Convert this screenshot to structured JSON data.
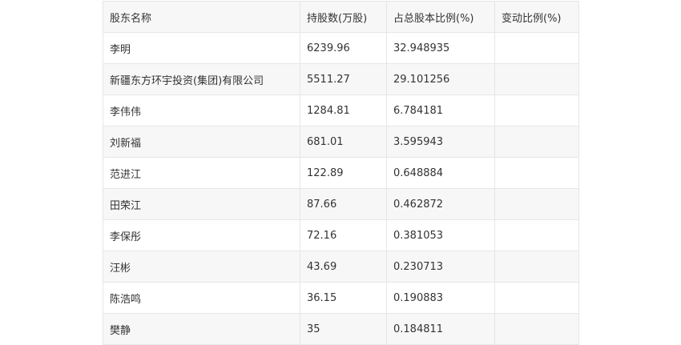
{
  "table": {
    "headers": [
      "股东名称",
      "持股数(万股)",
      "占总股本比例(%)",
      "变动比例(%)"
    ],
    "rows": [
      [
        "李明",
        "6239.96",
        "32.948935",
        ""
      ],
      [
        "新疆东方环宇投资(集团)有限公司",
        "5511.27",
        "29.101256",
        ""
      ],
      [
        "李伟伟",
        "1284.81",
        "6.784181",
        ""
      ],
      [
        "刘新福",
        "681.01",
        "3.595943",
        ""
      ],
      [
        "范进江",
        "122.89",
        "0.648884",
        ""
      ],
      [
        "田荣江",
        "87.66",
        "0.462872",
        ""
      ],
      [
        "李保彤",
        "72.16",
        "0.381053",
        ""
      ],
      [
        "汪彬",
        "43.69",
        "0.230713",
        ""
      ],
      [
        "陈浩鸣",
        "36.15",
        "0.190883",
        ""
      ],
      [
        "樊静",
        "35",
        "0.184811",
        ""
      ]
    ]
  }
}
